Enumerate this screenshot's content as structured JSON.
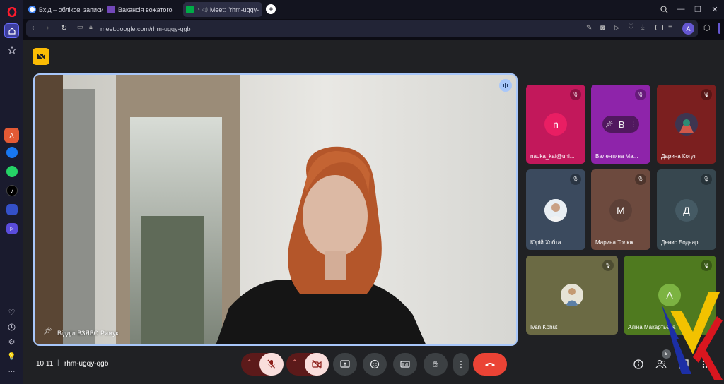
{
  "browser": {
    "tabs": [
      {
        "label": "Вхід – облікові записи Go"
      },
      {
        "label": "Вакансія вожатого"
      },
      {
        "label": "Meet: \"rhm-ugqy-"
      }
    ],
    "url": "meet.google.com/rhm-ugqy-qgb",
    "profile_initial": "A"
  },
  "meet": {
    "main_speaker": {
      "name": "Відділ ВЗЯВО Рижук"
    },
    "participants": [
      {
        "name": "nauka_kaf@uni...",
        "initial": "n",
        "bg": "#c2185b",
        "avatar_bg": "#e91e63"
      },
      {
        "name": "Валентина Ма...",
        "initial": "B",
        "bg": "#8e24aa",
        "avatar_bg": "#6a1b9a"
      },
      {
        "name": "Дарина Когут",
        "initial": "",
        "bg": "#7b1f1f",
        "avatar_bg": "#4a3a5a"
      },
      {
        "name": "Юрій Хобта",
        "initial": "",
        "bg": "#3b4a5e",
        "avatar_bg": "#dfe6ee"
      },
      {
        "name": "Марина Толюк",
        "initial": "M",
        "bg": "#6d4a3e",
        "avatar_bg": "#5d4037"
      },
      {
        "name": "Денис Боднар...",
        "initial": "Д",
        "bg": "#37474f",
        "avatar_bg": "#455a64"
      },
      {
        "name": "Ivan Kohut",
        "initial": "",
        "bg": "#6b6a44",
        "avatar_bg": "#e3e0d4"
      },
      {
        "name": "Аліна Макартьева",
        "initial": "A",
        "bg": "#4f7a1f",
        "avatar_bg": "#7cb342"
      }
    ],
    "time": "10:11",
    "meeting_code": "rhm-ugqy-qgb",
    "people_count": "9"
  },
  "colors": {
    "accent": "#a8c7fa",
    "end_call": "#ea4335",
    "off_control": "#f9dedc"
  }
}
